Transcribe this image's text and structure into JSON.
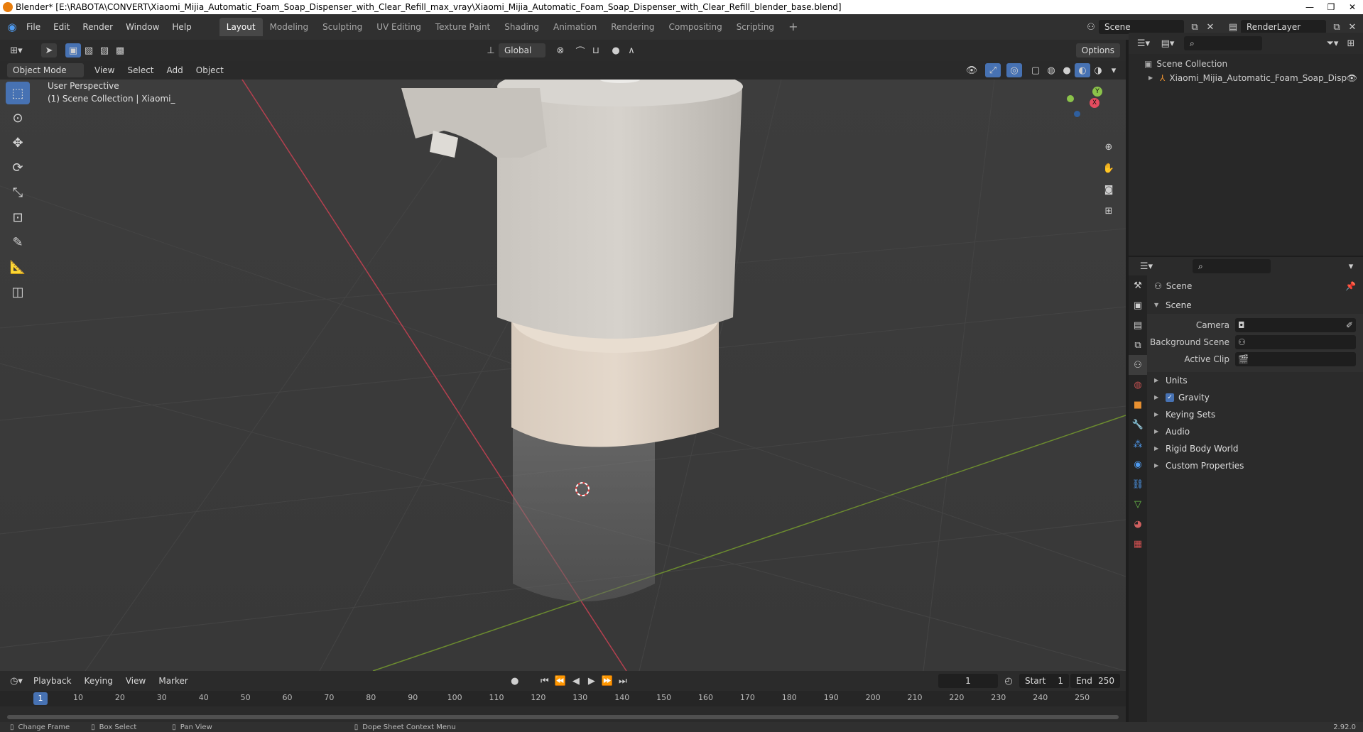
{
  "window": {
    "title": "Blender* [E:\\RABOTA\\CONVERT\\Xiaomi_Mijia_Automatic_Foam_Soap_Dispenser_with_Clear_Refill_max_vray\\Xiaomi_Mijia_Automatic_Foam_Soap_Dispenser_with_Clear_Refill_blender_base.blend]",
    "minimize": "—",
    "maximize": "❐",
    "close": "✕"
  },
  "menu": {
    "items": [
      "File",
      "Edit",
      "Render",
      "Window",
      "Help"
    ],
    "workspaces": [
      "Layout",
      "Modeling",
      "Sculpting",
      "UV Editing",
      "Texture Paint",
      "Shading",
      "Animation",
      "Rendering",
      "Compositing",
      "Scripting"
    ],
    "active_workspace": "Layout",
    "add_workspace": "+",
    "scene_name": "Scene",
    "render_layer": "RenderLayer"
  },
  "viewport_header": {
    "orientation": "Global",
    "options": "Options"
  },
  "viewport_subheader": {
    "mode": "Object Mode",
    "menus": [
      "View",
      "Select",
      "Add",
      "Object"
    ]
  },
  "viewport": {
    "perspective": "User Perspective",
    "collection_info": "(1) Scene Collection | Xiaomi_",
    "gizmo_axes": {
      "x": "X",
      "y": "Y",
      "z": "Z"
    },
    "colors": {
      "x": "#e44c5f",
      "y": "#8bc34a",
      "z": "#3a87e6",
      "bg": "#3b3b3b"
    }
  },
  "outliner": {
    "root": "Scene Collection",
    "object": "Xiaomi_Mijia_Automatic_Foam_Soap_Disper"
  },
  "properties": {
    "context": "Scene",
    "section": "Scene",
    "fields": [
      {
        "label": "Camera",
        "value": ""
      },
      {
        "label": "Background Scene",
        "value": ""
      },
      {
        "label": "Active Clip",
        "value": ""
      }
    ],
    "panels": [
      "Units",
      "Gravity",
      "Keying Sets",
      "Audio",
      "Rigid Body World",
      "Custom Properties"
    ],
    "gravity_checked": true
  },
  "timeline": {
    "menus": [
      "Playback",
      "Keying",
      "View",
      "Marker"
    ],
    "current_frame": "1",
    "start_label": "Start",
    "start": "1",
    "end_label": "End",
    "end": "250",
    "ticks": [
      "10",
      "20",
      "30",
      "40",
      "50",
      "60",
      "70",
      "80",
      "90",
      "100",
      "110",
      "120",
      "130",
      "140",
      "150",
      "160",
      "170",
      "180",
      "190",
      "200",
      "210",
      "220",
      "230",
      "240",
      "250"
    ],
    "playhead": "1",
    "accent": "#4772b3"
  },
  "statusbar": {
    "items": [
      "Change Frame",
      "Box Select",
      "Pan View",
      "Dope Sheet Context Menu"
    ],
    "version": "2.92.0"
  }
}
